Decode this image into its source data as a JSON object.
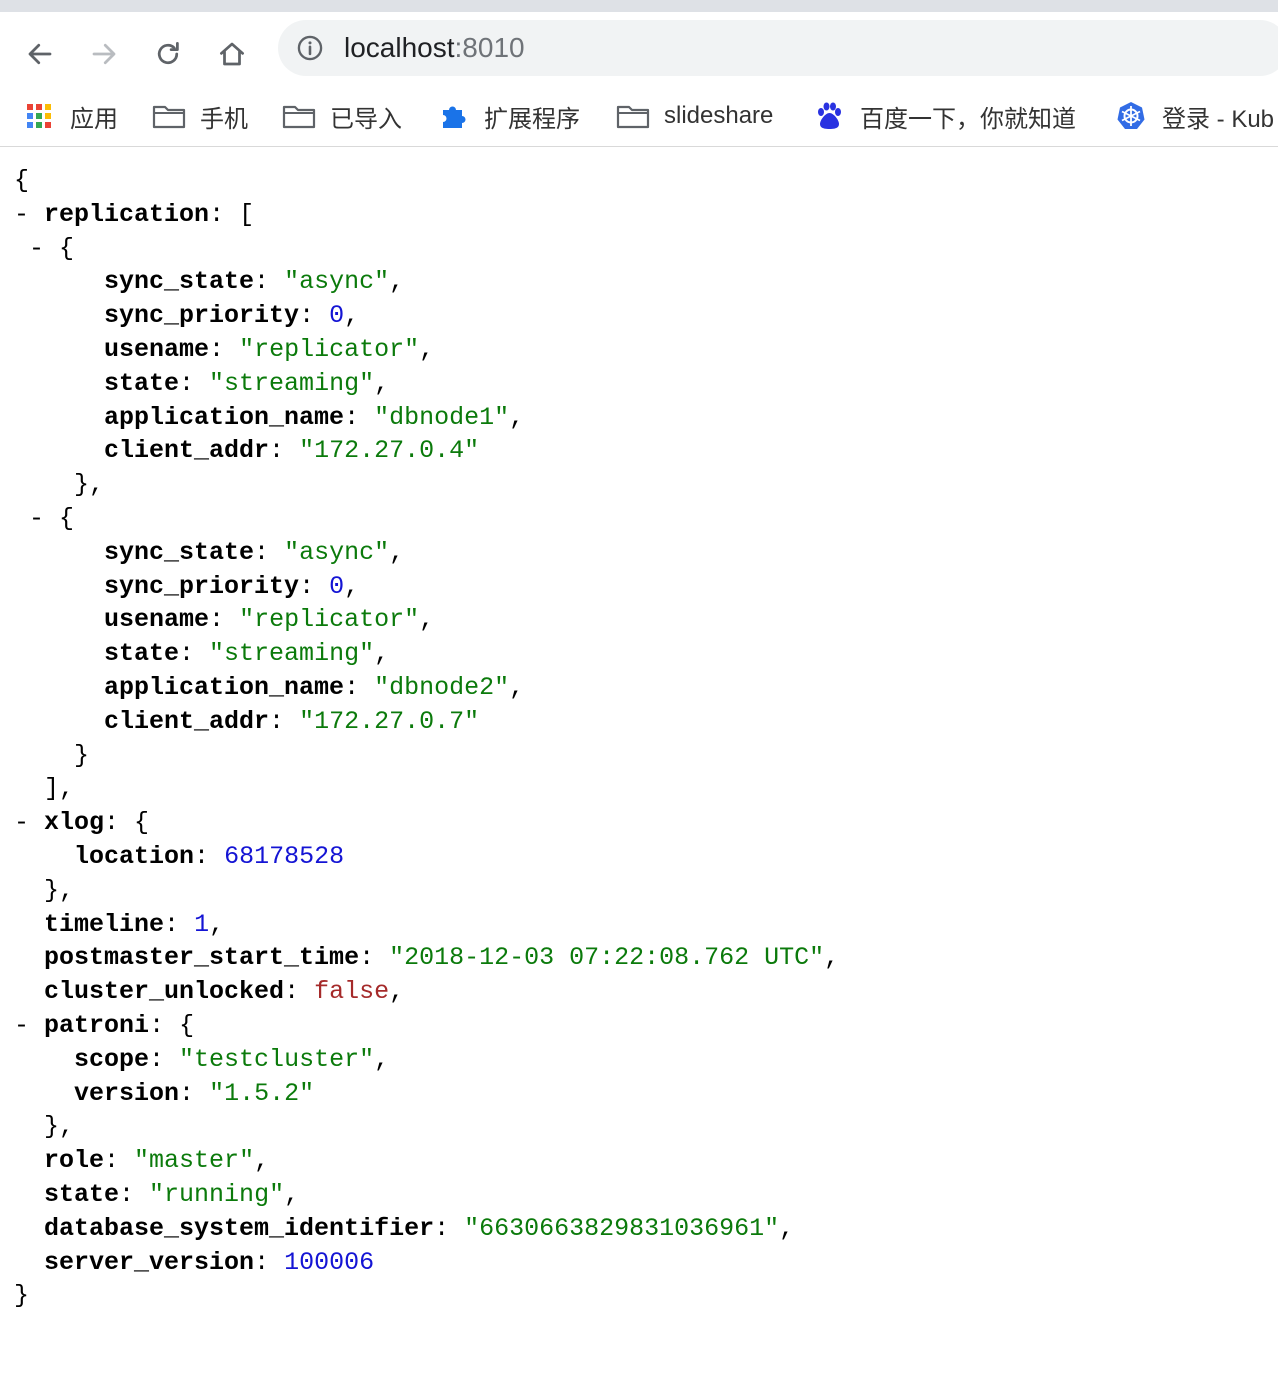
{
  "browser": {
    "url_host": "localhost",
    "url_port": ":8010",
    "bookmarks": [
      {
        "label": "应用",
        "icon": "apps-grid-icon"
      },
      {
        "label": "手机",
        "icon": "folder-icon"
      },
      {
        "label": "已导入",
        "icon": "folder-icon"
      },
      {
        "label": "扩展程序",
        "icon": "puzzle-icon"
      },
      {
        "label": "slideshare",
        "icon": "folder-icon"
      },
      {
        "label": "百度一下，你就知道",
        "icon": "baidu-paw-icon"
      },
      {
        "label": "登录 - Kub",
        "icon": "kubernetes-helm-icon"
      }
    ]
  },
  "viewer": {
    "toggle": "-",
    "lines": [
      {
        "t": "",
        "p": [
          {
            "c": "p",
            "v": "{"
          }
        ]
      },
      {
        "t": "-",
        "p": [
          {
            "c": "k",
            "v": "replication"
          },
          {
            "c": "p",
            "v": ": ["
          }
        ]
      },
      {
        "t": "-",
        "p": [
          {
            "c": "p",
            "v": "{"
          }
        ]
      },
      {
        "t": "",
        "p": [
          {
            "c": "k",
            "v": "sync_state"
          },
          {
            "c": "p",
            "v": ": "
          },
          {
            "c": "s",
            "v": "\"async\""
          },
          {
            "c": "p",
            "v": ","
          }
        ]
      },
      {
        "t": "",
        "p": [
          {
            "c": "k",
            "v": "sync_priority"
          },
          {
            "c": "p",
            "v": ": "
          },
          {
            "c": "n",
            "v": "0"
          },
          {
            "c": "p",
            "v": ","
          }
        ]
      },
      {
        "t": "",
        "p": [
          {
            "c": "k",
            "v": "usename"
          },
          {
            "c": "p",
            "v": ": "
          },
          {
            "c": "s",
            "v": "\"replicator\""
          },
          {
            "c": "p",
            "v": ","
          }
        ]
      },
      {
        "t": "",
        "p": [
          {
            "c": "k",
            "v": "state"
          },
          {
            "c": "p",
            "v": ": "
          },
          {
            "c": "s",
            "v": "\"streaming\""
          },
          {
            "c": "p",
            "v": ","
          }
        ]
      },
      {
        "t": "",
        "p": [
          {
            "c": "k",
            "v": "application_name"
          },
          {
            "c": "p",
            "v": ": "
          },
          {
            "c": "s",
            "v": "\"dbnode1\""
          },
          {
            "c": "p",
            "v": ","
          }
        ]
      },
      {
        "t": "",
        "p": [
          {
            "c": "k",
            "v": "client_addr"
          },
          {
            "c": "p",
            "v": ": "
          },
          {
            "c": "s",
            "v": "\"172.27.0.4\""
          }
        ]
      },
      {
        "t": "",
        "p": [
          {
            "c": "p",
            "v": "},"
          }
        ]
      },
      {
        "t": "-",
        "p": [
          {
            "c": "p",
            "v": "{"
          }
        ]
      },
      {
        "t": "",
        "p": [
          {
            "c": "k",
            "v": "sync_state"
          },
          {
            "c": "p",
            "v": ": "
          },
          {
            "c": "s",
            "v": "\"async\""
          },
          {
            "c": "p",
            "v": ","
          }
        ]
      },
      {
        "t": "",
        "p": [
          {
            "c": "k",
            "v": "sync_priority"
          },
          {
            "c": "p",
            "v": ": "
          },
          {
            "c": "n",
            "v": "0"
          },
          {
            "c": "p",
            "v": ","
          }
        ]
      },
      {
        "t": "",
        "p": [
          {
            "c": "k",
            "v": "usename"
          },
          {
            "c": "p",
            "v": ": "
          },
          {
            "c": "s",
            "v": "\"replicator\""
          },
          {
            "c": "p",
            "v": ","
          }
        ]
      },
      {
        "t": "",
        "p": [
          {
            "c": "k",
            "v": "state"
          },
          {
            "c": "p",
            "v": ": "
          },
          {
            "c": "s",
            "v": "\"streaming\""
          },
          {
            "c": "p",
            "v": ","
          }
        ]
      },
      {
        "t": "",
        "p": [
          {
            "c": "k",
            "v": "application_name"
          },
          {
            "c": "p",
            "v": ": "
          },
          {
            "c": "s",
            "v": "\"dbnode2\""
          },
          {
            "c": "p",
            "v": ","
          }
        ]
      },
      {
        "t": "",
        "p": [
          {
            "c": "k",
            "v": "client_addr"
          },
          {
            "c": "p",
            "v": ": "
          },
          {
            "c": "s",
            "v": "\"172.27.0.7\""
          }
        ]
      },
      {
        "t": "",
        "p": [
          {
            "c": "p",
            "v": "}"
          }
        ]
      },
      {
        "t": "",
        "p": [
          {
            "c": "p",
            "v": "],"
          }
        ]
      },
      {
        "t": "-",
        "p": [
          {
            "c": "k",
            "v": "xlog"
          },
          {
            "c": "p",
            "v": ": {"
          }
        ]
      },
      {
        "t": "",
        "p": [
          {
            "c": "k",
            "v": "location"
          },
          {
            "c": "p",
            "v": ": "
          },
          {
            "c": "n",
            "v": "68178528"
          }
        ]
      },
      {
        "t": "",
        "p": [
          {
            "c": "p",
            "v": "},"
          }
        ]
      },
      {
        "t": "",
        "p": [
          {
            "c": "k",
            "v": "timeline"
          },
          {
            "c": "p",
            "v": ": "
          },
          {
            "c": "n",
            "v": "1"
          },
          {
            "c": "p",
            "v": ","
          }
        ]
      },
      {
        "t": "",
        "p": [
          {
            "c": "k",
            "v": "postmaster_start_time"
          },
          {
            "c": "p",
            "v": ": "
          },
          {
            "c": "s",
            "v": "\"2018-12-03 07:22:08.762 UTC\""
          },
          {
            "c": "p",
            "v": ","
          }
        ]
      },
      {
        "t": "",
        "p": [
          {
            "c": "k",
            "v": "cluster_unlocked"
          },
          {
            "c": "p",
            "v": ": "
          },
          {
            "c": "b",
            "v": "false"
          },
          {
            "c": "p",
            "v": ","
          }
        ]
      },
      {
        "t": "-",
        "p": [
          {
            "c": "k",
            "v": "patroni"
          },
          {
            "c": "p",
            "v": ": {"
          }
        ]
      },
      {
        "t": "",
        "p": [
          {
            "c": "k",
            "v": "scope"
          },
          {
            "c": "p",
            "v": ": "
          },
          {
            "c": "s",
            "v": "\"testcluster\""
          },
          {
            "c": "p",
            "v": ","
          }
        ]
      },
      {
        "t": "",
        "p": [
          {
            "c": "k",
            "v": "version"
          },
          {
            "c": "p",
            "v": ": "
          },
          {
            "c": "s",
            "v": "\"1.5.2\""
          }
        ]
      },
      {
        "t": "",
        "p": [
          {
            "c": "p",
            "v": "},"
          }
        ]
      },
      {
        "t": "",
        "p": [
          {
            "c": "k",
            "v": "role"
          },
          {
            "c": "p",
            "v": ": "
          },
          {
            "c": "s",
            "v": "\"master\""
          },
          {
            "c": "p",
            "v": ","
          }
        ]
      },
      {
        "t": "",
        "p": [
          {
            "c": "k",
            "v": "state"
          },
          {
            "c": "p",
            "v": ": "
          },
          {
            "c": "s",
            "v": "\"running\""
          },
          {
            "c": "p",
            "v": ","
          }
        ]
      },
      {
        "t": "",
        "p": [
          {
            "c": "k",
            "v": "database_system_identifier"
          },
          {
            "c": "p",
            "v": ": "
          },
          {
            "c": "s",
            "v": "\"6630663829831036961\""
          },
          {
            "c": "p",
            "v": ","
          }
        ]
      },
      {
        "t": "",
        "p": [
          {
            "c": "k",
            "v": "server_version"
          },
          {
            "c": "p",
            "v": ": "
          },
          {
            "c": "n",
            "v": "100006"
          }
        ]
      },
      {
        "t": "",
        "p": [
          {
            "c": "p",
            "v": "}"
          }
        ]
      }
    ]
  },
  "colors": {
    "string": "#0b7a0b",
    "number": "#1414d4",
    "boolean": "#a52a2a",
    "key": "#000000",
    "omnibox_bg": "#f1f3f4",
    "tabstrip_bg": "#dee1e6"
  }
}
